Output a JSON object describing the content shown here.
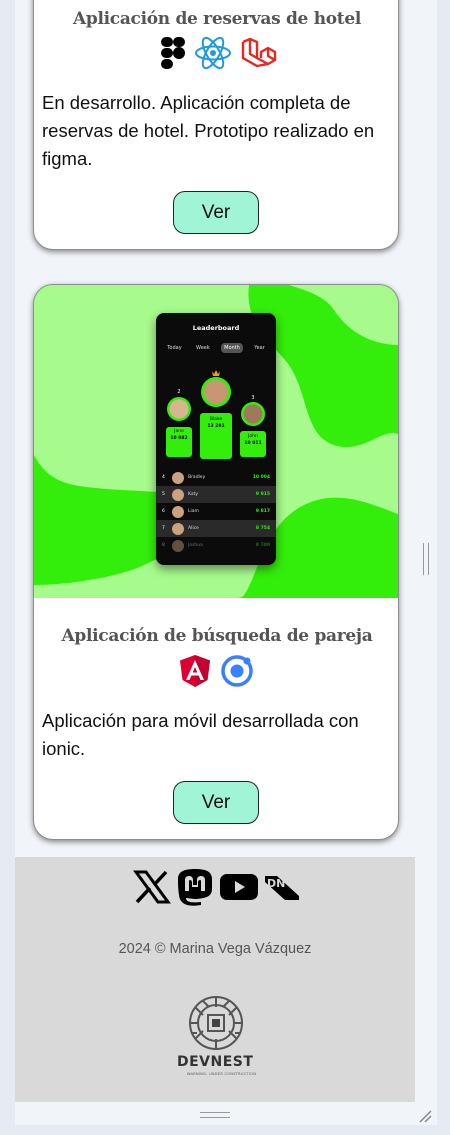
{
  "projects": [
    {
      "title": "Aplicación de reservas de hotel",
      "description": "En desarrollo. Aplicación completa de reservas de hotel. Prototipo realizado en figma.",
      "button_label": "Ver",
      "tech_icons": [
        "figma-icon",
        "react-icon",
        "laravel-icon"
      ]
    },
    {
      "title": "Aplicación de búsqueda de pareja",
      "description": "Aplicación para móvil desarrollada con ionic.",
      "button_label": "Ver",
      "tech_icons": [
        "angular-icon",
        "ionic-icon"
      ],
      "mockup": {
        "title": "Leaderboard",
        "tabs": [
          "Today",
          "Week",
          "Month",
          "Year"
        ],
        "active_tab": "Month",
        "podium": [
          {
            "rank": "2",
            "name": "Jane",
            "score": "10 082"
          },
          {
            "rank": "1",
            "name": "Blake",
            "score": "13 291"
          },
          {
            "rank": "3",
            "name": "John",
            "score": "10 011"
          }
        ],
        "rows": [
          {
            "rank": "4",
            "name": "Bradley",
            "score": "10 004"
          },
          {
            "rank": "5",
            "name": "Katy",
            "score": "9 915"
          },
          {
            "rank": "6",
            "name": "Liam",
            "score": "9 817"
          },
          {
            "rank": "7",
            "name": "Alice",
            "score": "8 754"
          },
          {
            "rank": "8",
            "name": "Joshua",
            "score": "8 700"
          }
        ]
      }
    }
  ],
  "footer": {
    "social_icons": [
      "x-icon",
      "mastodon-icon",
      "youtube-icon",
      "devnest-dn-icon"
    ],
    "copyright": "2024 © Marina Vega Vázquez",
    "logo_text": "DEVNEST",
    "logo_subtitle": "WARNING: UNDER CONSTRUCTION"
  },
  "colors": {
    "button_bg": "#9ff5d5",
    "mockup_green": "#33ee0b",
    "footer_bg": "#d8d9d8"
  }
}
